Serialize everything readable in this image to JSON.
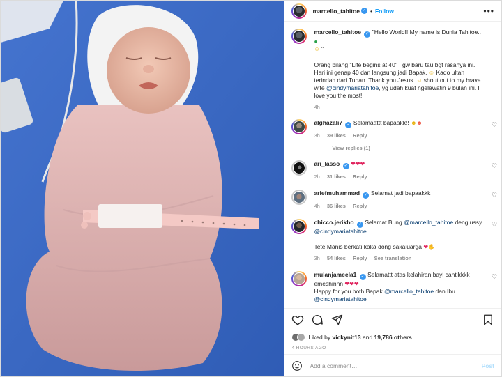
{
  "post": {
    "author": "marcello_tahitoe",
    "follow_label": "Follow",
    "dot": "•",
    "more_icon": "more-horizontal-icon"
  },
  "caption": {
    "username": "marcello_tahitoe",
    "line1": "\"Hello World!! My name is Dunia Tahitoe..",
    "line1b": "\"",
    "para2a": "Orang bilang \"Life begins at 40\" , gw baru tau bgt rasanya ini. Hari ini genap 40 dan langsung jadi Bapak.",
    "para2b": "Kado ultah terindah dari Tuhan. Thank you Jesus.",
    "para2c": "shout out to my brave wife",
    "mention": "@cindymariatahitoe",
    "para2d": ", yg udah kuat ngelewatin 9 bulan ini. I love you the most!",
    "time": "4h"
  },
  "comments": [
    {
      "username": "alghazali7",
      "text": "Selamaattt bapaakk!!",
      "time": "3h",
      "likes": "39 likes",
      "reply": "Reply",
      "view_replies": "View replies (1)"
    },
    {
      "username": "ari_lasso",
      "text": "",
      "time": "2h",
      "likes": "31 likes",
      "reply": "Reply"
    },
    {
      "username": "ariefmuhammad",
      "text": "Selamat jadi bapaakkk",
      "time": "4h",
      "likes": "36 likes",
      "reply": "Reply"
    },
    {
      "username": "chicco.jerikho",
      "text_a": "Selamat Bung",
      "mention_a": "@marcello_tahitoe",
      "text_b": "deng ussy",
      "mention_b": "@cindymariatahitoe",
      "text_c": "Tete Manis berkati kaka dong sakaluarga",
      "time": "3h",
      "likes": "54 likes",
      "reply": "Reply",
      "translation": "See translation"
    },
    {
      "username": "mulanjameela1",
      "text_a": "Selamattt atas kelahiran bayi cantikkkk emeshinnn",
      "text_b": "Happy for you both Bapak",
      "mention_a": "@marcello_tahitoe",
      "text_c": "dan Ibu",
      "mention_b": "@cindymariatahitoe"
    }
  ],
  "likes": {
    "prefix": "Liked by",
    "user": "vickynit13",
    "middle": "and",
    "count": "19,786 others"
  },
  "time_ago": "4 HOURS AGO",
  "add_comment": {
    "placeholder": "Add a comment…",
    "post_label": "Post"
  },
  "colors": {
    "accent": "#0095f6",
    "verified": "#3897f0",
    "background_photo": "#3b6cc8"
  }
}
